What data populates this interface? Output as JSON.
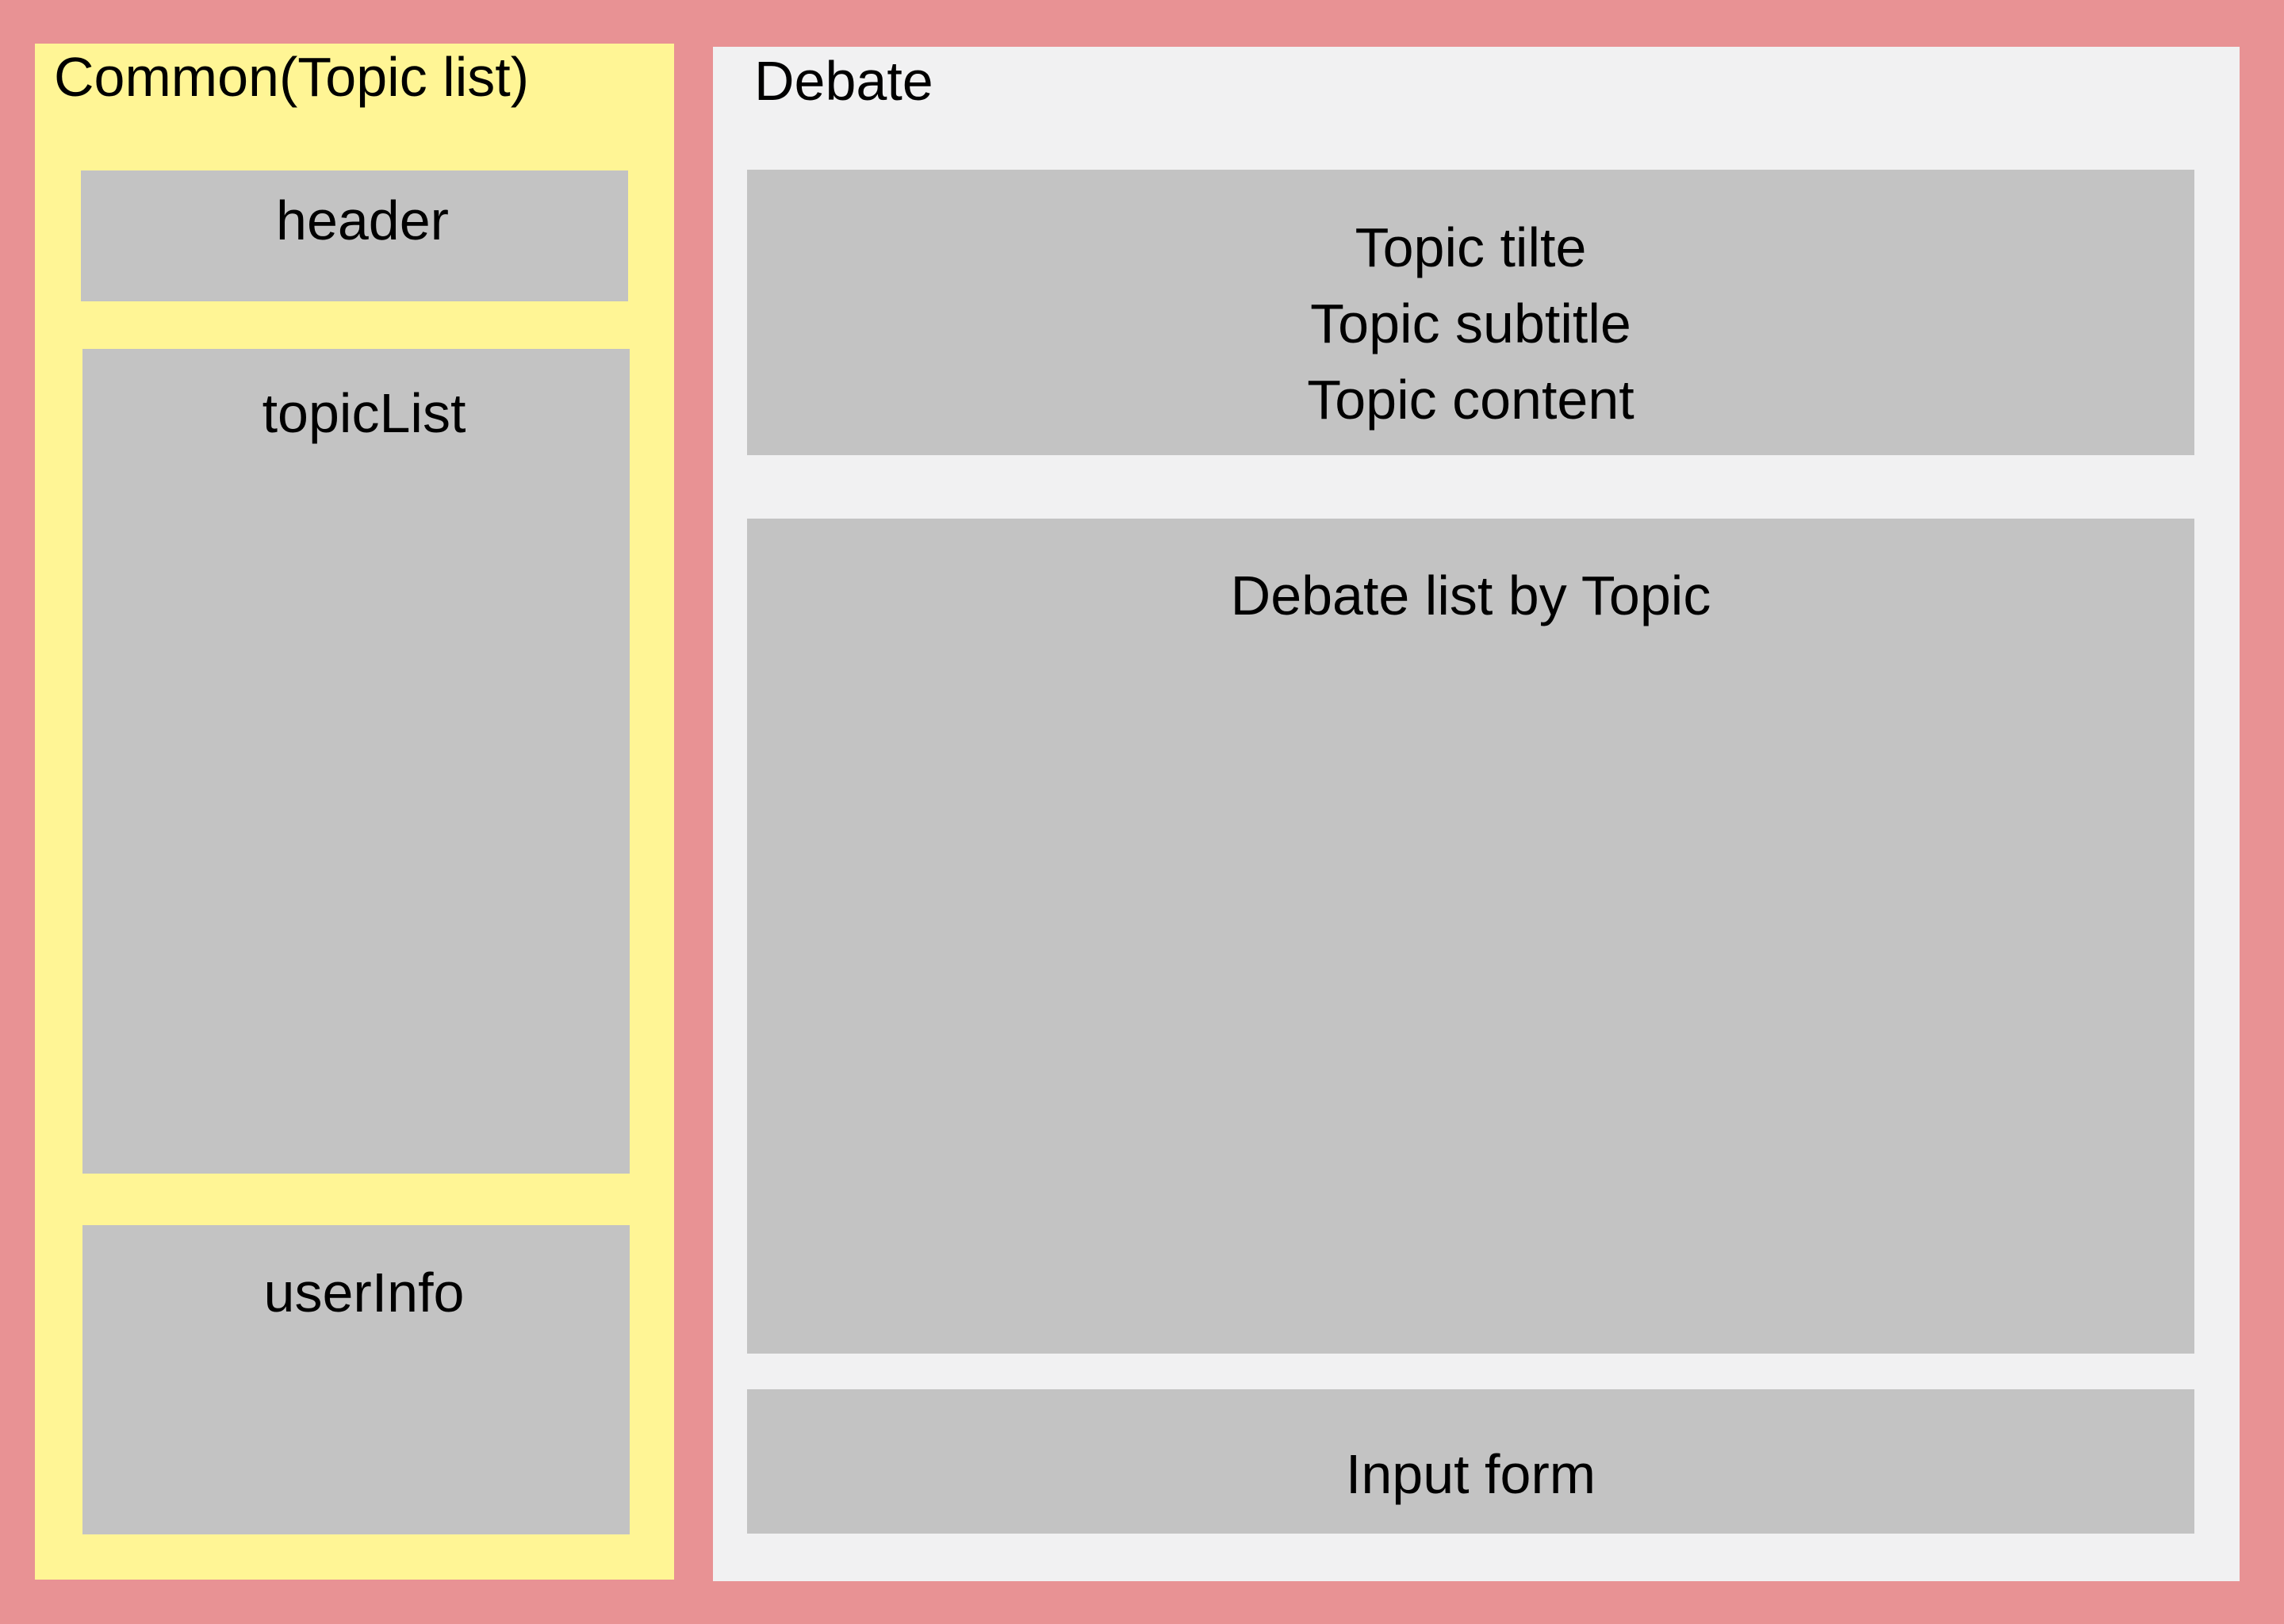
{
  "common": {
    "title": "Common(Topic list)",
    "header_label": "header",
    "topic_list_label": "topicList",
    "user_info_label": "userInfo"
  },
  "debate": {
    "title": "Debate",
    "topic": {
      "title": "Topic tilte",
      "subtitle": "Topic subtitle",
      "content": "Topic content"
    },
    "debate_list_label": "Debate list by Topic",
    "input_form_label": "Input form"
  },
  "colors": {
    "background": "#e89294",
    "common_panel": "#fff595",
    "debate_panel": "#f1f1f2",
    "box": "#c3c3c3"
  }
}
